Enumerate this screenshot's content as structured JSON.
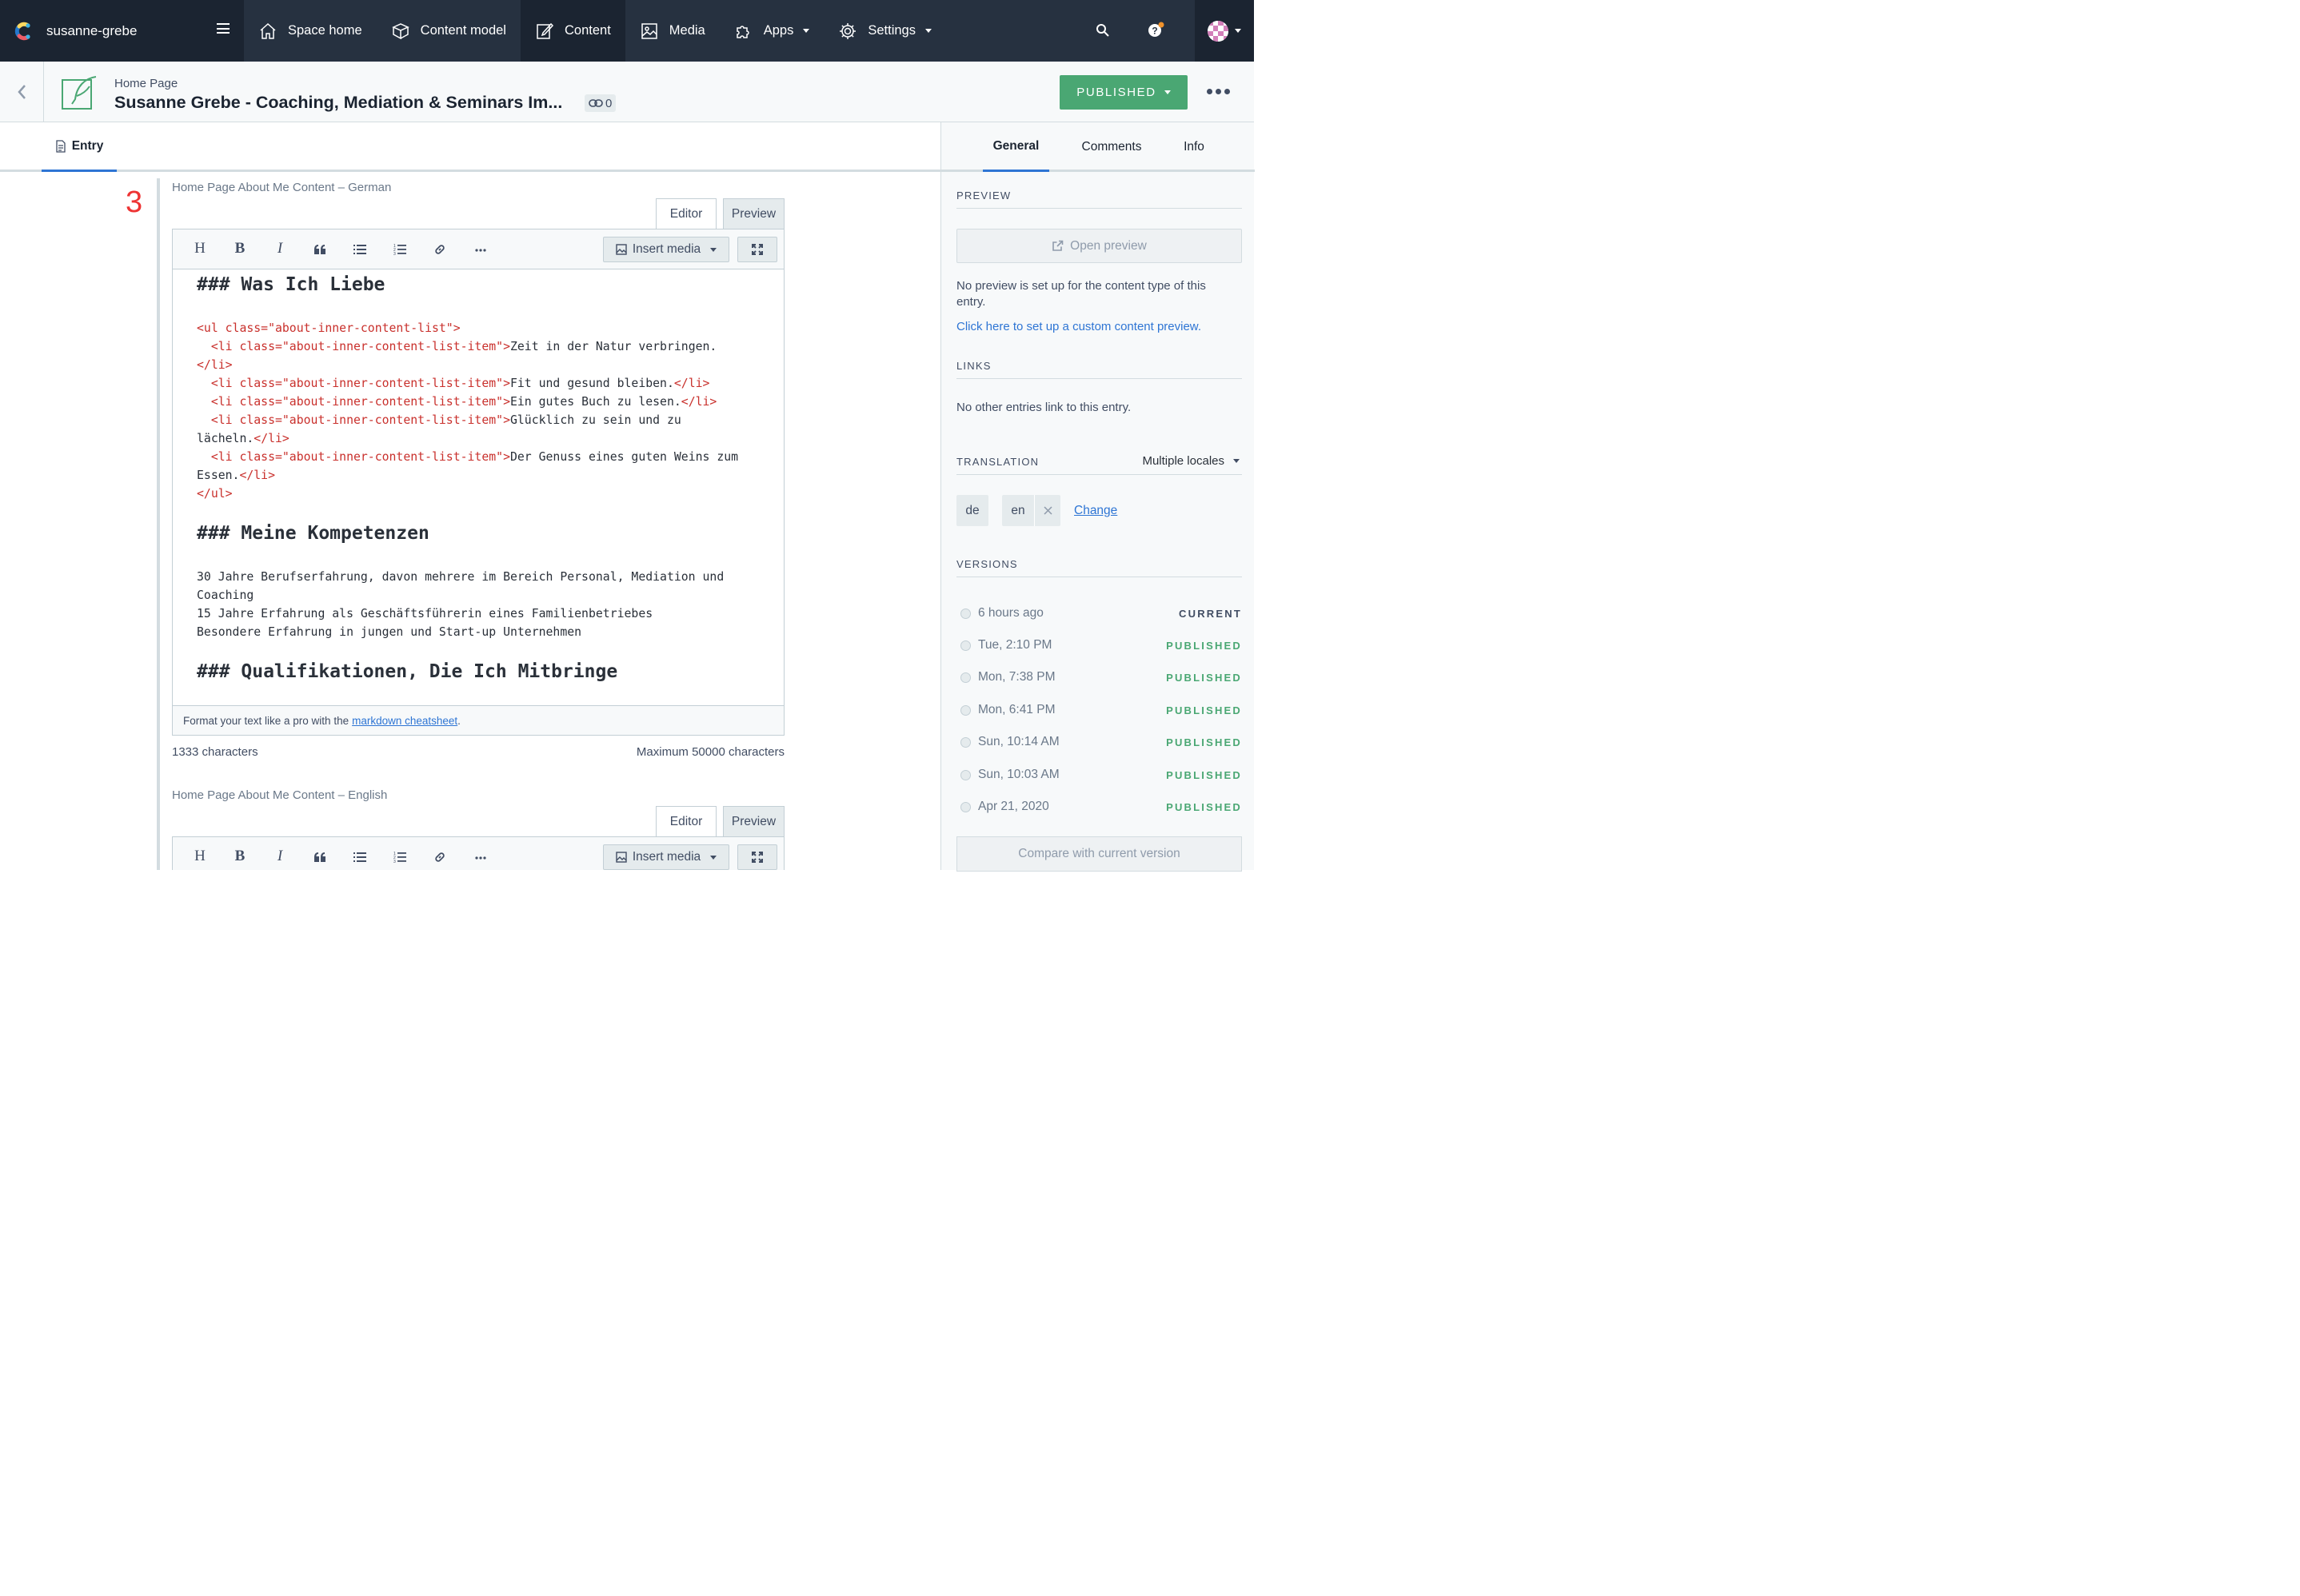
{
  "topbar": {
    "space_name": "susanne-grebe",
    "nav": [
      {
        "label": "Space home",
        "icon": "home-icon"
      },
      {
        "label": "Content model",
        "icon": "content-model-icon"
      },
      {
        "label": "Content",
        "icon": "content-icon",
        "active": true
      },
      {
        "label": "Media",
        "icon": "media-icon"
      },
      {
        "label": "Apps",
        "icon": "apps-icon",
        "dropdown": true
      },
      {
        "label": "Settings",
        "icon": "gear-icon",
        "dropdown": true
      }
    ]
  },
  "entry_header": {
    "content_type": "Home Page",
    "title": "Susanne Grebe - Coaching, Mediation & Seminars Im...",
    "link_count": "0",
    "status_button": "PUBLISHED"
  },
  "tabs": {
    "entry": "Entry"
  },
  "editor_annotation": "3",
  "field_de": {
    "label": "Home Page About Me Content – German",
    "tab_editor": "Editor",
    "tab_preview": "Preview",
    "toolbar": {
      "heading": "H",
      "bold": "B",
      "italic": "I",
      "insert_media": "Insert media"
    },
    "lines": {
      "l1": "### Was Ich Liebe",
      "l2a": "<ul class=\"about-inner-content-list\">",
      "l3a": "  <li class=\"about-inner-content-list-item\">",
      "l3b": "Zeit in der Natur verbringen.",
      "l4": "</li>",
      "l5a": "  <li class=\"about-inner-content-list-item\">",
      "l5b": "Fit und gesund bleiben.",
      "l5c": "</li>",
      "l6a": "  <li class=\"about-inner-content-list-item\">",
      "l6b": "Ein gutes Buch zu lesen.",
      "l6c": "</li>",
      "l7a": "  <li class=\"about-inner-content-list-item\">",
      "l7b": "Glücklich zu sein und zu",
      "l8a": "lächeln.",
      "l8b": "</li>",
      "l9a": "  <li class=\"about-inner-content-list-item\">",
      "l9b": "Der Genuss eines guten Weins zum",
      "l10a": "Essen.",
      "l10b": "</li>",
      "l11": "</ul>",
      "l12": "### Meine Kompetenzen",
      "l13": "30 Jahre Berufserfahrung, davon mehrere im Bereich Personal, Mediation und",
      "l14": "Coaching",
      "l15": "15 Jahre Erfahrung als Geschäftsführerin eines Familienbetriebes",
      "l16": "Besondere Erfahrung in jungen und Start-up Unternehmen",
      "l17": "### Qualifikationen, Die Ich Mitbringe"
    },
    "footer_text": "Format your text like a pro with the",
    "footer_link": "markdown cheatsheet",
    "footer_end": ".",
    "char_count": "1333 characters",
    "max_chars": "Maximum 50000 characters"
  },
  "field_en": {
    "label": "Home Page About Me Content – English",
    "tab_editor": "Editor",
    "tab_preview": "Preview",
    "toolbar": {
      "heading": "H",
      "bold": "B",
      "italic": "I",
      "insert_media": "Insert media"
    }
  },
  "sidebar": {
    "tabs": {
      "general": "General",
      "comments": "Comments",
      "info": "Info"
    },
    "preview": {
      "heading": "PREVIEW",
      "button": "Open preview",
      "note": "No preview is set up for the content type of this entry.",
      "link": "Click here to set up a custom content preview."
    },
    "links": {
      "heading": "LINKS",
      "note": "No other entries link to this entry."
    },
    "translation": {
      "heading": "TRANSLATION",
      "mode": "Multiple locales",
      "locales": [
        "de",
        "en"
      ],
      "change": "Change"
    },
    "versions": {
      "heading": "VERSIONS",
      "items": [
        {
          "time": "6 hours ago",
          "status": "CURRENT"
        },
        {
          "time": "Tue, 2:10 PM",
          "status": "PUBLISHED"
        },
        {
          "time": "Mon, 7:38 PM",
          "status": "PUBLISHED"
        },
        {
          "time": "Mon, 6:41 PM",
          "status": "PUBLISHED"
        },
        {
          "time": "Sun, 10:14 AM",
          "status": "PUBLISHED"
        },
        {
          "time": "Sun, 10:03 AM",
          "status": "PUBLISHED"
        },
        {
          "time": "Apr 21, 2020",
          "status": "PUBLISHED"
        }
      ],
      "compare": "Compare with current version"
    }
  },
  "colors": {
    "published": "#4aa773",
    "link": "#2e75d4",
    "topbar": "#263140",
    "code_tag": "#c9302c"
  }
}
